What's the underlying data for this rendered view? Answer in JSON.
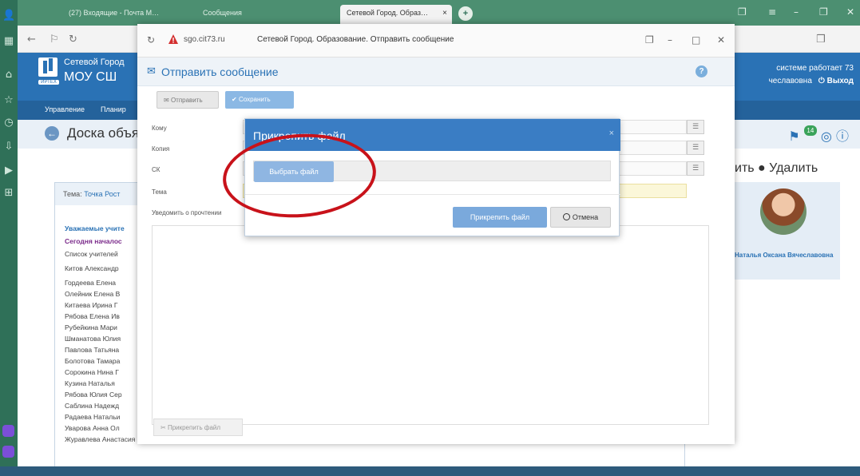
{
  "browser": {
    "tabs": [
      {
        "label": "(27) Входящие - Почта М…"
      },
      {
        "label": "Сообщения"
      },
      {
        "label": "Сетевой Город. Образ…"
      }
    ],
    "new_tab_symbol": "+",
    "close_symbol": "×"
  },
  "site": {
    "name": "Сетевой Город",
    "school": "МОУ СШ",
    "logo_label": "ИРТЕХ",
    "status_text": "системе работает 73",
    "user_text": "чеславовна",
    "logout_label": "Выход",
    "menu": [
      "Управление",
      "Планир"
    ]
  },
  "board": {
    "title": "Доска объя",
    "delete_label": "ить ● Удалить",
    "badge_count": "14",
    "topic_label": "Тема:",
    "topic_value": "Точка Рост",
    "post_lines": [
      {
        "text": "Уважаемые учите",
        "style": "blue"
      },
      {
        "text": "Сегодня началос",
        "style": "purple"
      },
      {
        "text": "Список учителей",
        "style": "plain"
      },
      {
        "text": "Китов Александр",
        "style": "plain"
      },
      {
        "text": "Гордеева Елена",
        "style": "plain"
      },
      {
        "text": "Олейник Елена В",
        "style": "plain"
      },
      {
        "text": "Китаева Ирина Г",
        "style": "plain"
      },
      {
        "text": "Рябова Елена Ив",
        "style": "plain"
      },
      {
        "text": "Рубейкина Мари",
        "style": "plain"
      },
      {
        "text": "Шманатова Юлия",
        "style": "plain"
      },
      {
        "text": "Павлова Татьяна",
        "style": "plain"
      },
      {
        "text": "Болотова Тамара",
        "style": "plain"
      },
      {
        "text": "Сорокина Нина Г",
        "style": "plain"
      },
      {
        "text": "Кузина Наталья",
        "style": "plain"
      },
      {
        "text": "Рябова Юлия Сер",
        "style": "plain"
      },
      {
        "text": "Саблина Надежд",
        "style": "plain"
      },
      {
        "text": "Радаева Натальи",
        "style": "plain"
      },
      {
        "text": "Уварова Анна Ол",
        "style": "plain"
      },
      {
        "text": "Журавлева Анастасия Владимировна,",
        "style": "plain"
      }
    ],
    "author_name": "Наталья Оксана Вячеславовна"
  },
  "popup": {
    "url": "sgo.cit73.ru",
    "page_title": "Сетевой Город. Образование. Отправить сообщение",
    "compose_title": "Отправить сообщение",
    "help_symbol": "?",
    "toolbar": {
      "send_label": "Отправить",
      "save_label": "Сохранить"
    },
    "fields": {
      "to_label": "Кому",
      "copy_label": "Копия",
      "bcc_label": "СК",
      "subject_label": "Тема",
      "notify_label": "Уведомить о прочтении"
    },
    "attach_file_label": "Прикрепить файл"
  },
  "modal": {
    "title": "Прикрепить файл",
    "choose_file_label": "Выбрать файл",
    "attach_button_label": "Прикрепить файл",
    "cancel_button_label": "Отмена",
    "close_symbol": "×"
  },
  "colors": {
    "highlight": "#c8121a",
    "accent": "#2a72b5",
    "modal_header": "#3a7dc4"
  }
}
